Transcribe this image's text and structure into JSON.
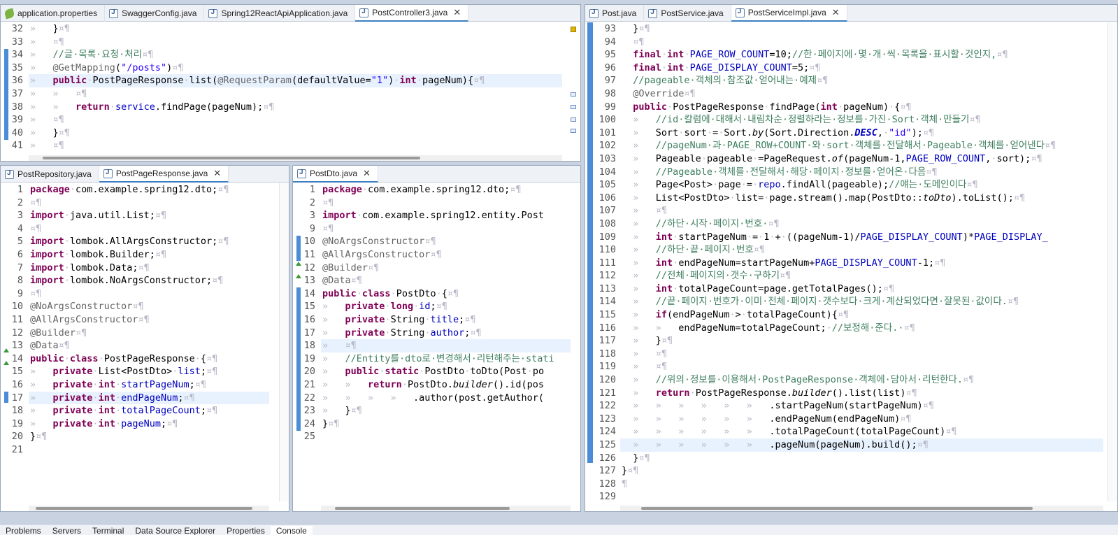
{
  "panes": {
    "top_left": {
      "tabs": [
        {
          "label": "application.properties",
          "icon": "properties-file-icon"
        },
        {
          "label": "SwaggerConfig.java",
          "icon": "java-file-icon"
        },
        {
          "label": "Spring12ReactApiApplication.java",
          "icon": "java-file-icon"
        },
        {
          "label": "PostController3.java",
          "icon": "java-file-icon",
          "active": true,
          "close": "✕"
        }
      ]
    },
    "right": {
      "tabs": [
        {
          "label": "Post.java",
          "icon": "java-file-icon"
        },
        {
          "label": "PostService.java",
          "icon": "java-file-icon"
        },
        {
          "label": "PostServiceImpl.java",
          "icon": "java-file-icon",
          "active": true,
          "close": "✕"
        }
      ]
    },
    "bottom_left": {
      "tabs": [
        {
          "label": "PostRepository.java",
          "icon": "java-file-icon"
        },
        {
          "label": "PostPageResponse.java",
          "icon": "java-file-icon",
          "active": true,
          "close": "✕"
        }
      ]
    },
    "bottom_mid": {
      "tabs": [
        {
          "label": "PostDto.java",
          "icon": "java-file-icon",
          "active": true,
          "close": "✕"
        }
      ]
    }
  },
  "bottom_bar": {
    "tabs": [
      "Problems",
      "Servers",
      "Terminal",
      "Data Source Explorer",
      "Properties",
      "Console"
    ]
  },
  "colors": {
    "keyword": "#7f0055",
    "string": "#2a00ff",
    "comment": "#3f7f5f",
    "annotation": "#646464",
    "field": "#0000c0",
    "current_line": "#e8f2fe",
    "tab_active_underline": "#3c7fc1"
  }
}
